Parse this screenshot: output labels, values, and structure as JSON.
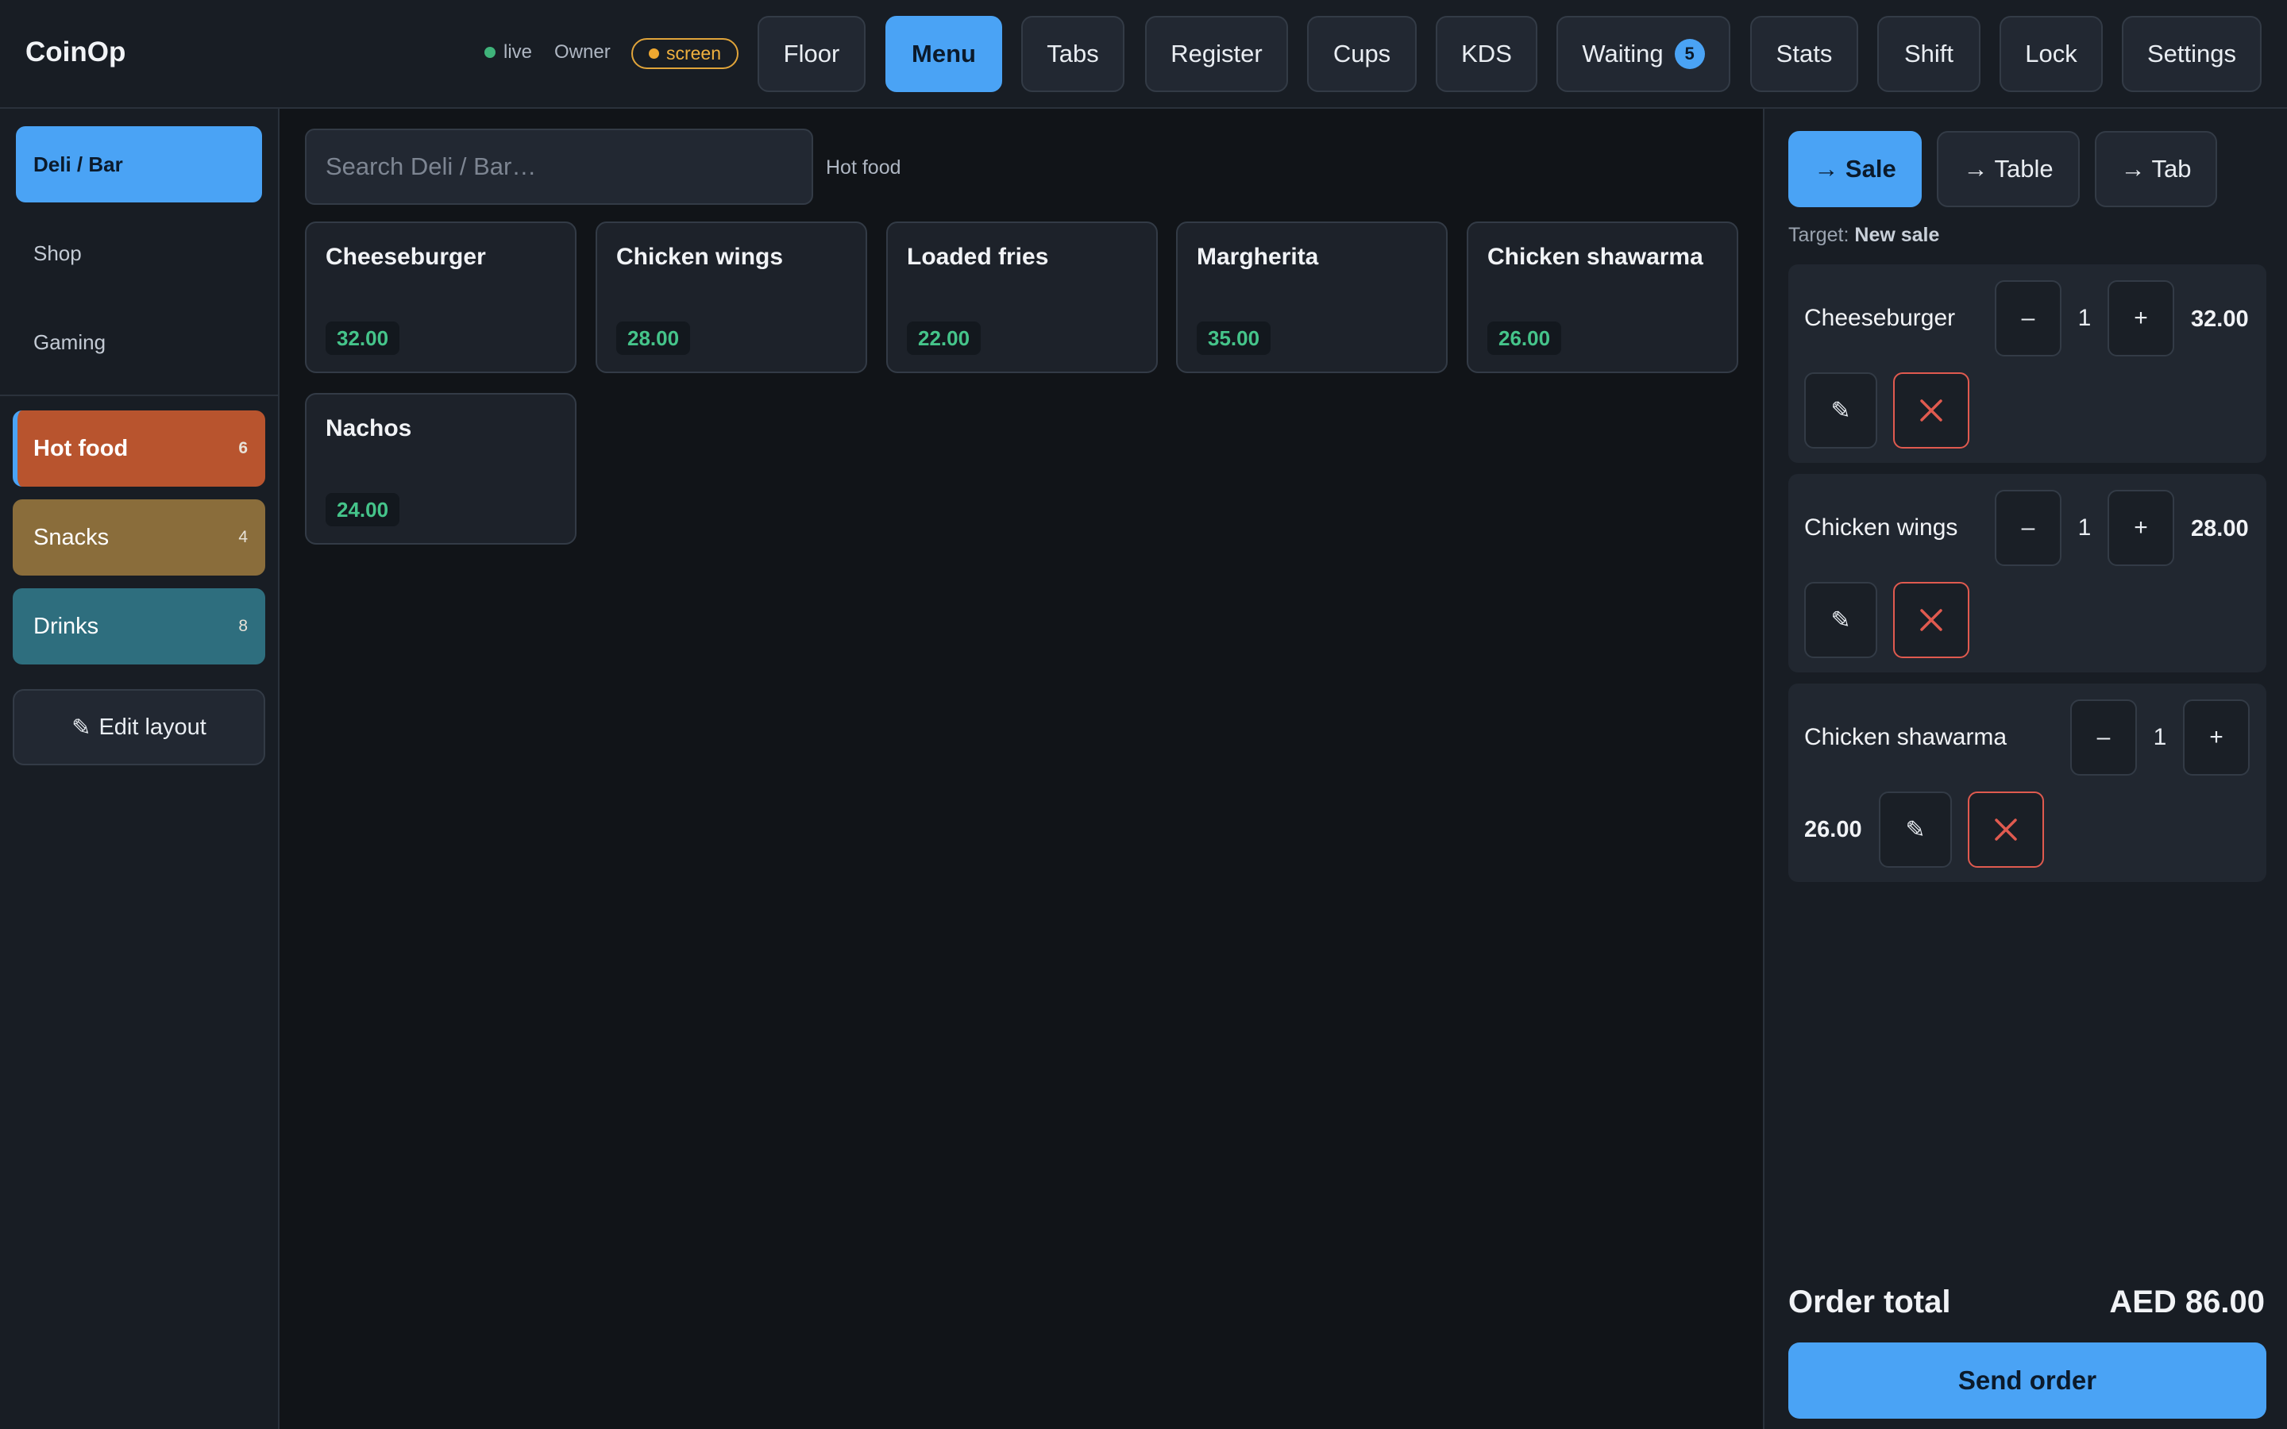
{
  "app": {
    "title": "CoinOp"
  },
  "header": {
    "status": {
      "live_label": "live",
      "role": "Owner",
      "mode_label": "screen",
      "live_color": "#3fb37a",
      "mode_color": "#f0a830"
    },
    "nav": [
      {
        "label": "Floor"
      },
      {
        "label": "Menu",
        "active": true
      },
      {
        "label": "Tabs"
      },
      {
        "label": "Register"
      },
      {
        "label": "Cups"
      },
      {
        "label": "KDS"
      },
      {
        "label": "Waiting",
        "badge": "5"
      },
      {
        "label": "Stats"
      },
      {
        "label": "Shift"
      },
      {
        "label": "Lock"
      },
      {
        "label": "Settings"
      }
    ]
  },
  "sidebar": {
    "venues": [
      {
        "label": "Deli / Bar",
        "active": true
      },
      {
        "label": "Shop"
      },
      {
        "label": "Gaming"
      }
    ],
    "categories": [
      {
        "label": "Hot food",
        "count": "6",
        "color": "#b8542e",
        "active": true
      },
      {
        "label": "Snacks",
        "count": "4",
        "color": "#8a6d3b"
      },
      {
        "label": "Drinks",
        "count": "8",
        "color": "#2e6e7e"
      }
    ],
    "edit_layout": {
      "icon": "pencil-icon",
      "glyph": "✎",
      "label": "Edit layout"
    }
  },
  "main": {
    "search": {
      "placeholder": "Search Deli / Bar…",
      "value": ""
    },
    "current_category": "Hot food",
    "items": [
      {
        "name": "Cheeseburger",
        "price": "32.00"
      },
      {
        "name": "Chicken wings",
        "price": "28.00"
      },
      {
        "name": "Loaded fries",
        "price": "22.00"
      },
      {
        "name": "Margherita",
        "price": "35.00"
      },
      {
        "name": "Chicken shawarma",
        "price": "26.00"
      },
      {
        "name": "Nachos",
        "price": "24.00"
      }
    ]
  },
  "order": {
    "targets": [
      {
        "label": "→ Sale",
        "active": true
      },
      {
        "label": "→ Table"
      },
      {
        "label": "→ Tab"
      }
    ],
    "target_prefix": "Target:",
    "target_value": "New sale",
    "lines": [
      {
        "name": "Cheeseburger",
        "qty": "1",
        "price": "32.00"
      },
      {
        "name": "Chicken wings",
        "qty": "1",
        "price": "28.00"
      },
      {
        "name": "Chicken shawarma",
        "qty": "1",
        "price": "26.00"
      }
    ],
    "minus_glyph": "–",
    "plus_glyph": "+",
    "edit_glyph": "✎",
    "total_label": "Order total",
    "total_value": "AED 86.00",
    "send_label": "Send order"
  },
  "colors": {
    "accent": "#4aa3f5",
    "price_green": "#45c48a",
    "danger": "#e05a4f",
    "background": "#111418"
  }
}
